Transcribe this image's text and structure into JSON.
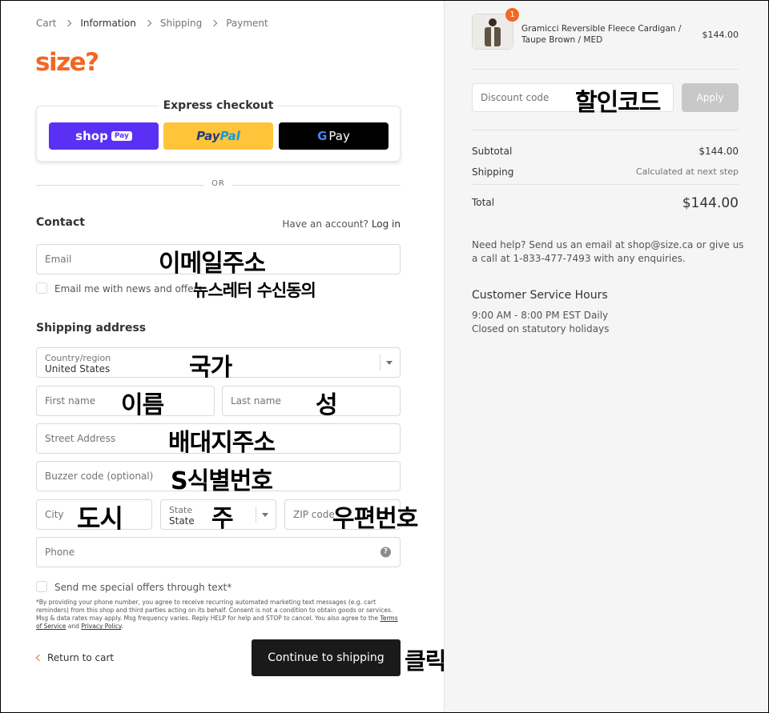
{
  "breadcrumbs": [
    {
      "label": "Cart"
    },
    {
      "label": "Information"
    },
    {
      "label": "Shipping"
    },
    {
      "label": "Payment"
    }
  ],
  "logo": "size?",
  "express": {
    "title": "Express checkout",
    "shop_label": "shop",
    "shop_badge": "Pay",
    "paypal_a": "Pay",
    "paypal_b": "Pal",
    "gpay_g": "G",
    "gpay_label": "Pay"
  },
  "or_text": "OR",
  "contact": {
    "heading": "Contact",
    "have_account": "Have an account?",
    "login": "Log in",
    "email_placeholder": "Email",
    "email_ko": "이메일주소",
    "newsletter_label": "Email me with news and offers",
    "newsletter_ko": "뉴스레터 수신동의"
  },
  "shipping": {
    "heading": "Shipping address",
    "country_label": "Country/region",
    "country_value": "United States",
    "country_ko": "국가",
    "first_name": "First name",
    "first_name_ko": "이름",
    "last_name": "Last name",
    "last_name_ko": "성",
    "street": "Street Address",
    "street_ko": "배대지주소",
    "buzzer": "Buzzer code (optional)",
    "buzzer_ko": "S식별번호",
    "city": "City",
    "city_ko": "도시",
    "state_label": "State",
    "state_value": "State",
    "state_ko": "주",
    "zip": "ZIP code",
    "zip_ko": "우편번호",
    "phone": "Phone",
    "phone_help": "?",
    "sms_label": "Send me special offers through text*"
  },
  "disclaimer": {
    "text": "*By providing your phone number, you agree to receive recurring automated marketing text messages (e.g. cart reminders) from this shop and third parties acting on its behalf. Consent is not a condition to obtain goods or services. Msg & data rates may apply. Msg frequency varies. Reply HELP for help and STOP to cancel. You also agree to the ",
    "terms": "Terms of Service",
    "and": " and ",
    "privacy": "Privacy Policy",
    "end": "."
  },
  "actions": {
    "return": "Return to cart",
    "continue": "Continue to shipping",
    "click_ko": "클릭"
  },
  "summary": {
    "qty_badge": "1",
    "product_name": "Gramicci Reversible Fleece Cardigan / Taupe Brown / MED",
    "product_price": "$144.00",
    "discount_placeholder": "Discount code",
    "discount_ko": "할인코드",
    "apply": "Apply",
    "subtotal_label": "Subtotal",
    "subtotal_value": "$144.00",
    "shipping_label": "Shipping",
    "shipping_value": "Calculated at next step",
    "total_label": "Total",
    "total_value": "$144.00",
    "help": "Need help? Send us an email at shop@size.ca or give us a call at 1-833-477-7493 with any enquiries.",
    "hours_title": "Customer Service Hours",
    "hours_line1": "9:00 AM - 8:00 PM EST Daily",
    "hours_line2": "Closed on statutory holidays"
  },
  "colors": {
    "accent": "#f26722",
    "shop_pay": "#5a31f4",
    "paypal": "#ffc439",
    "continue_btn": "#1a1a1a"
  }
}
